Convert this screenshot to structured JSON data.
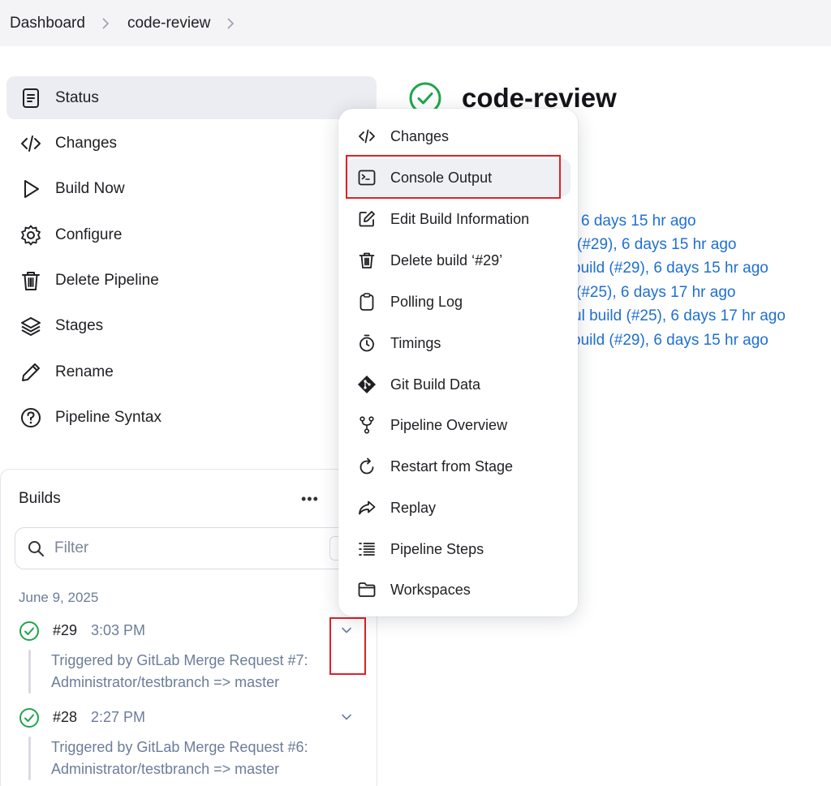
{
  "breadcrumb": {
    "items": [
      "Dashboard",
      "code-review"
    ]
  },
  "sidebar": {
    "items": [
      {
        "label": "Status",
        "icon": "document-icon"
      },
      {
        "label": "Changes",
        "icon": "code-icon"
      },
      {
        "label": "Build Now",
        "icon": "play-icon"
      },
      {
        "label": "Configure",
        "icon": "gear-icon"
      },
      {
        "label": "Delete Pipeline",
        "icon": "trash-icon"
      },
      {
        "label": "Stages",
        "icon": "layers-icon"
      },
      {
        "label": "Rename",
        "icon": "pencil-icon"
      },
      {
        "label": "Pipeline Syntax",
        "icon": "help-icon"
      }
    ]
  },
  "builds": {
    "title": "Builds",
    "more": "•••",
    "filter_placeholder": "Filter",
    "date": "June 9, 2025",
    "rows": [
      {
        "num": "#29",
        "time": "3:03 PM",
        "desc1": "Triggered by GitLab Merge Request #7:",
        "desc2": "Administrator/testbranch => master"
      },
      {
        "num": "#28",
        "time": "2:27 PM",
        "desc1": "Triggered by GitLab Merge Request #6:",
        "desc2": "Administrator/testbranch => master"
      }
    ]
  },
  "main": {
    "title": "code-review",
    "links": [
      "6 days 15 hr ago",
      "(#29), 6 days 15 hr ago",
      "build (#29), 6 days 15 hr ago",
      "(#25), 6 days 17 hr ago",
      "ul build (#25), 6 days 17 hr ago",
      "build (#29), 6 days 15 hr ago"
    ]
  },
  "menu": {
    "items": [
      {
        "label": "Changes",
        "icon": "code-icon"
      },
      {
        "label": "Console Output",
        "icon": "terminal-icon"
      },
      {
        "label": "Edit Build Information",
        "icon": "edit-icon"
      },
      {
        "label": "Delete build ‘#29’",
        "icon": "trash-icon"
      },
      {
        "label": "Polling Log",
        "icon": "clipboard-icon"
      },
      {
        "label": "Timings",
        "icon": "stopwatch-icon"
      },
      {
        "label": "Git Build Data",
        "icon": "git-icon"
      },
      {
        "label": "Pipeline Overview",
        "icon": "branch-icon"
      },
      {
        "label": "Restart from Stage",
        "icon": "restart-icon"
      },
      {
        "label": "Replay",
        "icon": "replay-icon"
      },
      {
        "label": "Pipeline Steps",
        "icon": "steps-icon"
      },
      {
        "label": "Workspaces",
        "icon": "folder-icon"
      }
    ]
  },
  "colors": {
    "accent": "#1f6fd0",
    "success": "#1ea64a",
    "highlight": "#e0202a"
  }
}
